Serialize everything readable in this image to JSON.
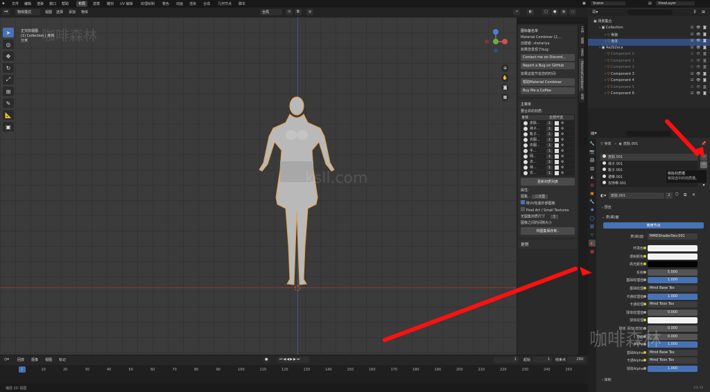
{
  "menu": {
    "items": [
      "文件",
      "编辑",
      "渲染",
      "窗口",
      "帮助"
    ],
    "workspaces": [
      "布局",
      "建模",
      "雕刻",
      "UV 编辑",
      "纹理绘制",
      "着色",
      "动画",
      "渲染",
      "合成",
      "几何节点",
      "脚本"
    ],
    "active_workspace": "布局",
    "scene": "Scene",
    "view_layer": "ViewLayer"
  },
  "header": {
    "mode": "物体模式",
    "menus": [
      "视图",
      "选择",
      "添加",
      "物体"
    ],
    "transform": "全局"
  },
  "viewport": {
    "info_line1": "正交前视图",
    "info_line2": "(1) Collection | 身体",
    "info_line3": "分米",
    "watermark": "咖啡森林",
    "watermark2": "ksll.com"
  },
  "side_tabs": [
    "工具",
    "视图",
    "MMD",
    "MaterialCombiner",
    "杂项"
  ],
  "npanel": {
    "section1_title": "图标备名单",
    "addon_name": "Material Combiner (2,...",
    "creator_label": "创建者:",
    "creator": "shotariya",
    "bug_label": "如果您发现了bug:",
    "discord": "Contact me on Discord...",
    "github": "Report a Bug on GitHub",
    "support_label": "如果这能节省您的时间:",
    "patreon": "帮助Material Combiner",
    "coffee": "Buy Me a Coffee",
    "section2_title": "主菜单",
    "combine_label": "要合并的材质:",
    "col_header1": "身体",
    "col_header2": "全部开选",
    "materials": [
      "皮肤...",
      "袜子...",
      "靴子...",
      "衣服...",
      "衣服...",
      "手...",
      "网...",
      "衣...",
      "袜...",
      "衣..."
    ],
    "update_button": "更新材质列表",
    "props_label": "属性:",
    "size_label": "图集...",
    "size_value": "二次型",
    "uv_toggle": "将UV包装外部图像",
    "pixel_art": "Pixel Art / Small Textures",
    "max_size_label": "无图集材质尺寸",
    "max_size_value": "3",
    "gap_label": "图像之间的间隙大小",
    "save_button": "将图集保存到..",
    "update_section": "更新"
  },
  "outliner": {
    "root": "场景集合",
    "rows": [
      {
        "label": "Collection",
        "indent": 1,
        "dim": false
      },
      {
        "label": "骨骼",
        "indent": 2,
        "dim": false
      },
      {
        "label": "身体",
        "indent": 2,
        "dim": false,
        "selected": true
      },
      {
        "label": "4a2b2eca",
        "indent": 1,
        "dim": false
      },
      {
        "label": "Component 0",
        "indent": 2,
        "dim": true
      },
      {
        "label": "Component 1",
        "indent": 2,
        "dim": true
      },
      {
        "label": "Component 2",
        "indent": 2,
        "dim": true
      },
      {
        "label": "Component 3",
        "indent": 2,
        "dim": false
      },
      {
        "label": "Component 4",
        "indent": 2,
        "dim": false
      },
      {
        "label": "Component 5",
        "indent": 2,
        "dim": true
      },
      {
        "label": "Component 6",
        "indent": 2,
        "dim": false
      }
    ]
  },
  "properties": {
    "breadcrumb_obj": "身体",
    "breadcrumb_mat": "皮肤.001",
    "slots": [
      "皮肤.001",
      "袜子.001",
      "靴子.001",
      "裙带.001",
      "衣饰带.001"
    ],
    "tooltip_title": "移除材质槽",
    "tooltip_body": "移除选中的材质槽。",
    "material_name": "皮肤.001",
    "user_count": "2",
    "preview_section": "预览",
    "surface_section": "表(曲)面",
    "use_nodes": "使用节点",
    "surface_label": "表(曲)面",
    "surface_value": "MMDShaderDev.001",
    "rows": [
      {
        "label": "环境色",
        "value": "",
        "kind": "white"
      },
      {
        "label": "漫射颜色",
        "value": "",
        "kind": "white"
      },
      {
        "label": "高光颜色",
        "value": "",
        "kind": "black"
      },
      {
        "label": "反射",
        "value": "5.000",
        "kind": "num"
      },
      {
        "label": "基础纹理值",
        "value": "1.000",
        "kind": "blue"
      },
      {
        "label": "基础纹理",
        "value": "Mmd Base Tex",
        "kind": "link"
      },
      {
        "label": "卡通纹理值",
        "value": "1.000",
        "kind": "blue"
      },
      {
        "label": "卡通纹理",
        "value": "Mmd Toon Tex",
        "kind": "link"
      },
      {
        "label": "球体纹理值",
        "value": "0.000",
        "kind": "num"
      },
      {
        "label": "球体纹理",
        "value": "",
        "kind": "white"
      },
      {
        "label": "球体 添加(增加)",
        "value": "0.000",
        "kind": "num"
      },
      {
        "label": "双面",
        "value": "0.000",
        "kind": "num"
      },
      {
        "label": "Alpha",
        "value": "1.000",
        "kind": "blue"
      },
      {
        "label": "基础Alpha",
        "value": "Mmd Base Tex",
        "kind": "link"
      },
      {
        "label": "卡通Alpha",
        "value": "Mmd Toon Tex",
        "kind": "link"
      },
      {
        "label": "球体Alpha",
        "value": "1.000",
        "kind": "blue"
      }
    ],
    "volume_section": "体积",
    "version": "3.6.15"
  },
  "timeline": {
    "menus": [
      "回放",
      "抠像",
      "视图",
      "标记"
    ],
    "current_frame": "1",
    "start_label": "起始",
    "start": "1",
    "end_label": "结束点",
    "end": "250",
    "ticks": [
      "1",
      "10",
      "20",
      "30",
      "40",
      "50",
      "60",
      "70",
      "80",
      "90",
      "100",
      "110",
      "120",
      "130",
      "140",
      "150",
      "160",
      "170",
      "180",
      "190",
      "200",
      "210",
      "220",
      "230",
      "240",
      "250"
    ],
    "status": "缩放 2D 视图"
  },
  "colors": {
    "accent": "#4772b3",
    "arrow": "#ff1010",
    "selection": "#e8a040"
  }
}
